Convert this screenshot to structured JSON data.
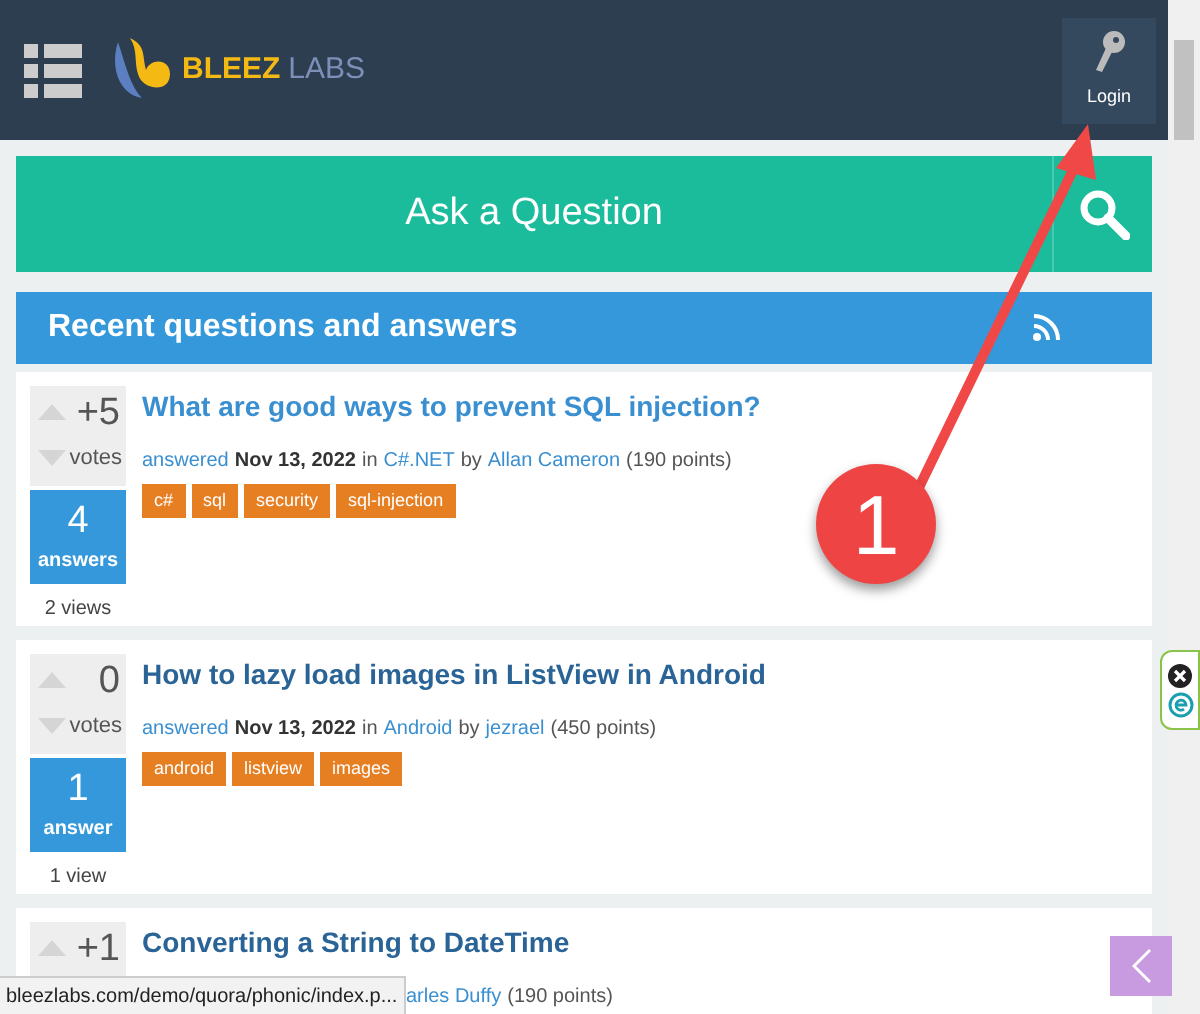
{
  "header": {
    "logo_text_1": "BLEEZ",
    "logo_text_2": "LABS",
    "login": "Login"
  },
  "ask": {
    "label": "Ask a Question"
  },
  "section": {
    "title": "Recent questions and answers"
  },
  "questions": [
    {
      "votes": "+5",
      "votes_label": "votes",
      "answers": "4",
      "answers_label": "answers",
      "views": "2 views",
      "title": "What are good ways to prevent SQL injection?",
      "hovered": true,
      "meta_cut": false,
      "meta": [
        {
          "kind": "link",
          "text": "answered"
        },
        {
          "kind": "bold",
          "text": "Nov 13, 2022"
        },
        {
          "kind": "plain",
          "text": "in"
        },
        {
          "kind": "link",
          "text": "C#.NET"
        },
        {
          "kind": "plain",
          "text": "by"
        },
        {
          "kind": "link",
          "text": "Allan Cameron"
        },
        {
          "kind": "plain",
          "text": "(190 points)"
        }
      ],
      "tags": [
        "c#",
        "sql",
        "security",
        "sql-injection"
      ]
    },
    {
      "votes": "0",
      "votes_label": "votes",
      "answers": "1",
      "answers_label": "answer",
      "views": "1 view",
      "title": "How to lazy load images in ListView in Android",
      "hovered": false,
      "meta_cut": false,
      "meta": [
        {
          "kind": "link",
          "text": "answered"
        },
        {
          "kind": "bold",
          "text": "Nov 13, 2022"
        },
        {
          "kind": "plain",
          "text": "in"
        },
        {
          "kind": "link",
          "text": "Android"
        },
        {
          "kind": "plain",
          "text": "by"
        },
        {
          "kind": "link",
          "text": "jezrael"
        },
        {
          "kind": "plain",
          "text": "(450 points)"
        }
      ],
      "tags": [
        "android",
        "listview",
        "images"
      ]
    },
    {
      "votes": "+1",
      "title": "Converting a String to DateTime",
      "hovered": false,
      "meta_cut": true,
      "meta": [
        {
          "kind": "link",
          "text": "arles Duffy"
        },
        {
          "kind": "plain",
          "text": "(190 points)"
        }
      ]
    }
  ],
  "status_bar": {
    "url": "bleezlabs.com/demo/quora/phonic/index.p..."
  },
  "annotation": {
    "label": "1"
  }
}
